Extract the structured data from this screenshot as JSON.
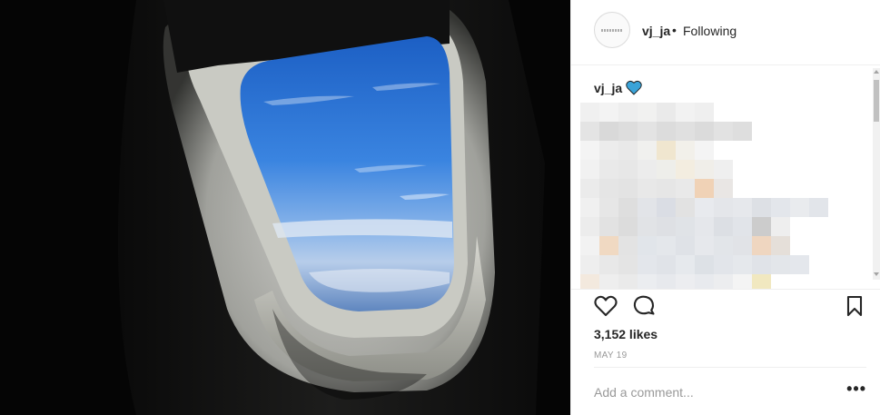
{
  "post": {
    "image": {
      "description_icon": "airplane-window-photo"
    }
  },
  "header": {
    "username": "vj_ja",
    "separator": "•",
    "follow_status": "Following"
  },
  "caption": {
    "username": "vj_ja",
    "heart_color": "#3897f0",
    "text_obscured": true
  },
  "actions": {
    "like_icon": "heart-outline-icon",
    "comment_icon": "comment-bubble-icon",
    "save_icon": "bookmark-icon"
  },
  "stats": {
    "likes": "3,152 likes",
    "date": "MAY 19"
  },
  "comment": {
    "placeholder": "Add a comment...",
    "more": "•••"
  },
  "colors": {
    "text": "#262626",
    "muted": "#999999",
    "border": "#efefef",
    "heart_blue": "#3897f0"
  }
}
